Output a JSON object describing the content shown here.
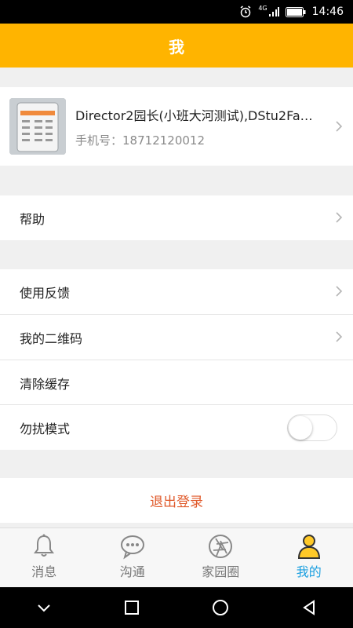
{
  "status_bar": {
    "time": "14:46",
    "network": "4G"
  },
  "header": {
    "title": "我"
  },
  "profile": {
    "name": "Director2园长(小班大河测试),DStu2Fa…",
    "phone_label": "手机号：",
    "phone": "18712120012"
  },
  "menu": {
    "help": "帮助",
    "feedback": "使用反馈",
    "qrcode": "我的二维码",
    "clear_cache": "清除缓存",
    "dnd": "勿扰模式",
    "dnd_on": false
  },
  "logout": "退出登录",
  "tabs": [
    {
      "label": "消息",
      "icon": "bell-icon"
    },
    {
      "label": "沟通",
      "icon": "chat-icon"
    },
    {
      "label": "家园圈",
      "icon": "camera-aperture-icon"
    },
    {
      "label": "我的",
      "icon": "user-icon",
      "active": true
    }
  ],
  "colors": {
    "accent": "#ffb400",
    "active_tab": "#1a9fe0",
    "logout": "#e05a2b"
  }
}
